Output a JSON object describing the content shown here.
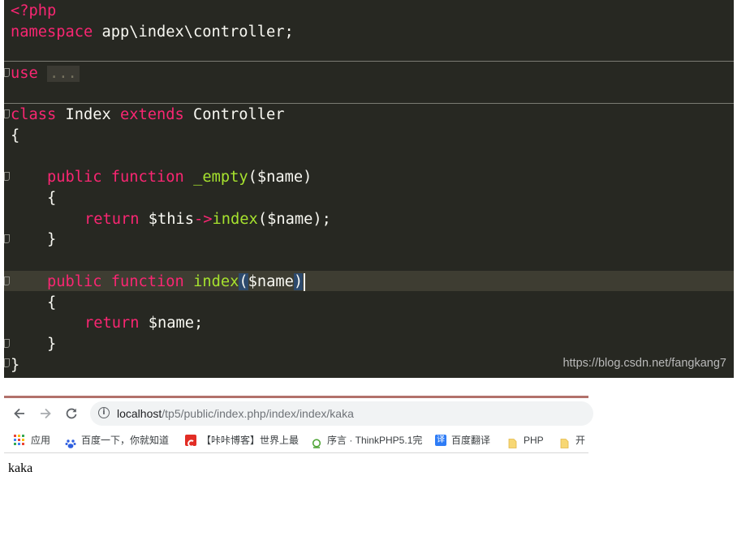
{
  "editor": {
    "theme_bg": "#272822",
    "lines": {
      "l1": "<?php",
      "l2_kw": "namespace",
      "l2_rest": " app\\index\\controller;",
      "l3_kw": "use",
      "l3_collapsed": "...",
      "l4_kw": "class",
      "l4_name": " Index ",
      "l4_kw2": "extends",
      "l4_parent": " Controller",
      "l5": "{",
      "l6_kw": "public",
      "l6_kw2": "function",
      "l6_fn": "_empty",
      "l6_args": "($name)",
      "l7": "{",
      "l8_kw": "return",
      "l8_this": " $this",
      "l8_arrow": "->",
      "l8_fn": "index",
      "l8_rest": "($name);",
      "l9": "}",
      "l10_kw": "public",
      "l10_kw2": "function",
      "l10_fn": "index",
      "l10_open": "(",
      "l10_arg": "$name",
      "l10_close": ")",
      "l11": "{",
      "l12_kw": "return",
      "l12_rest": " $name;",
      "l13": "}",
      "l14": "}"
    },
    "watermark": "https://blog.csdn.net/fangkang7"
  },
  "browser": {
    "accent": "#b2716b",
    "nav": {
      "back_icon": "arrow-left-icon",
      "forward_icon": "arrow-right-icon",
      "reload_icon": "reload-icon"
    },
    "url_host": "localhost",
    "url_path": "/tp5/public/index.php/index/index/kaka",
    "bookmarks": {
      "apps": "应用",
      "baidu": "百度一下，你就知道",
      "csdn": "【咔咔博客】世界上最",
      "thinkphp": "序言 · ThinkPHP5.1完",
      "fanyi": "百度翻译",
      "php": "PHP",
      "kai": "开"
    },
    "page_text": "kaka"
  }
}
